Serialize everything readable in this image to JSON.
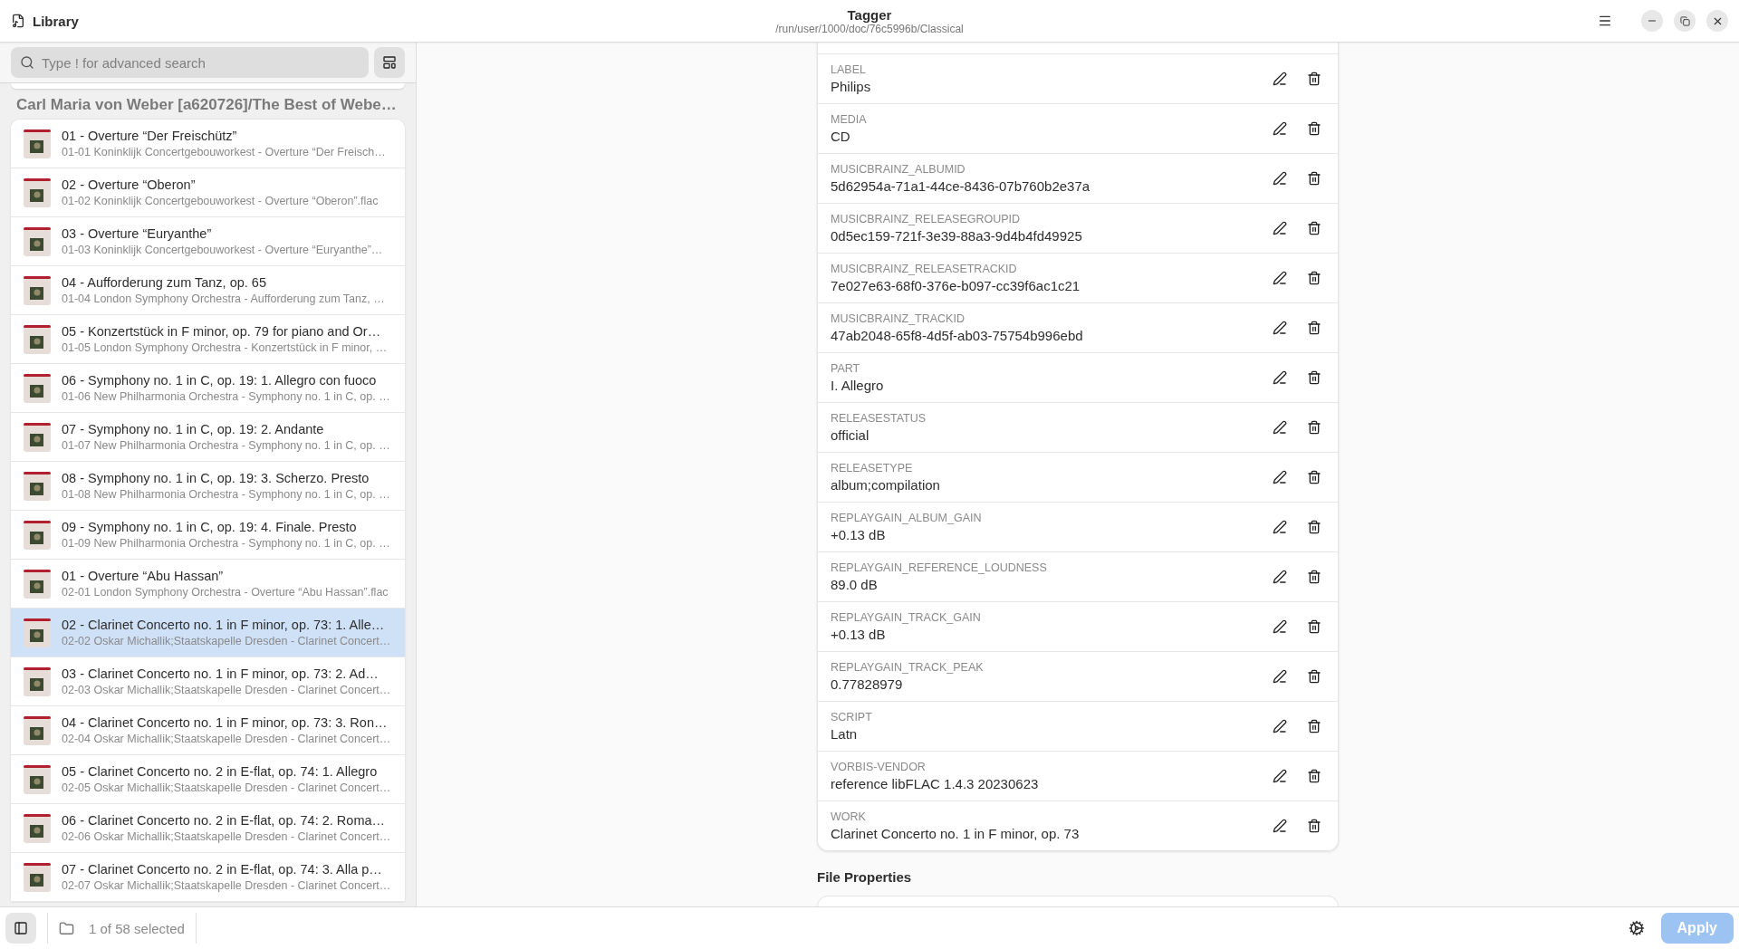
{
  "header": {
    "left_title": "Library",
    "title": "Tagger",
    "subtitle": "/run/user/1000/doc/76c5996b/Classical"
  },
  "search": {
    "placeholder": "Type ! for advanced search"
  },
  "album": {
    "heading": "Carl Maria von Weber [a620726]/The Best of Webe…"
  },
  "tracks": [
    {
      "title": "01 - Overture “Der Freischütz”",
      "file": "01-01 Koninklijk Concertgebouworkest - Overture “Der Freisch…",
      "selected": false
    },
    {
      "title": "02 - Overture “Oberon”",
      "file": "01-02 Koninklijk Concertgebouworkest - Overture “Oberon”.flac",
      "selected": false
    },
    {
      "title": "03 - Overture “Euryanthe”",
      "file": "01-03 Koninklijk Concertgebouworkest - Overture “Euryanthe”…",
      "selected": false
    },
    {
      "title": "04 - Aufforderung zum Tanz, op. 65",
      "file": "01-04 London Symphony Orchestra - Aufforderung zum Tanz, …",
      "selected": false
    },
    {
      "title": "05 - Konzertstück in F minor, op. 79 for piano and Or…",
      "file": "01-05 London Symphony Orchestra - Konzertstück in F minor, …",
      "selected": false
    },
    {
      "title": "06 - Symphony no. 1 in C, op. 19: 1. Allegro con fuoco",
      "file": "01-06 New Philharmonia Orchestra - Symphony no. 1 in C, op. …",
      "selected": false
    },
    {
      "title": "07 - Symphony no. 1 in C, op. 19: 2. Andante",
      "file": "01-07 New Philharmonia Orchestra - Symphony no. 1 in C, op. …",
      "selected": false
    },
    {
      "title": "08 - Symphony no. 1 in C, op. 19: 3. Scherzo. Presto",
      "file": "01-08 New Philharmonia Orchestra - Symphony no. 1 in C, op. …",
      "selected": false
    },
    {
      "title": "09 - Symphony no. 1 in C, op. 19: 4. Finale. Presto",
      "file": "01-09 New Philharmonia Orchestra - Symphony no. 1 in C, op. …",
      "selected": false
    },
    {
      "title": "01 - Overture “Abu Hassan”",
      "file": "02-01 London Symphony Orchestra - Overture “Abu Hassan”.flac",
      "selected": false
    },
    {
      "title": "02 - Clarinet Concerto no. 1 in F minor, op. 73: 1. Alle…",
      "file": "02-02 Oskar Michallik;Staatskapelle Dresden - Clarinet Concert…",
      "selected": true
    },
    {
      "title": "03 - Clarinet Concerto no. 1 in F minor, op. 73: 2. Ad…",
      "file": "02-03 Oskar Michallik;Staatskapelle Dresden - Clarinet Concert…",
      "selected": false
    },
    {
      "title": "04 - Clarinet Concerto no. 1 in F minor, op. 73: 3. Ron…",
      "file": "02-04 Oskar Michallik;Staatskapelle Dresden - Clarinet Concert…",
      "selected": false
    },
    {
      "title": "05 - Clarinet Concerto no. 2 in E-flat, op. 74: 1. Allegro",
      "file": "02-05 Oskar Michallik;Staatskapelle Dresden - Clarinet Concert…",
      "selected": false
    },
    {
      "title": "06 - Clarinet Concerto no. 2 in E-flat, op. 74: 2. Roma…",
      "file": "02-06 Oskar Michallik;Staatskapelle Dresden - Clarinet Concert…",
      "selected": false
    },
    {
      "title": "07 - Clarinet Concerto no. 2 in E-flat, op. 74: 3. Alla p…",
      "file": "02-07 Oskar Michallik;Staatskapelle Dresden - Clarinet Concert…",
      "selected": false
    }
  ],
  "tags": [
    {
      "name": "LABEL",
      "value": "Philips"
    },
    {
      "name": "MEDIA",
      "value": "CD"
    },
    {
      "name": "MUSICBRAINZ_ALBUMID",
      "value": "5d62954a-71a1-44ce-8436-07b760b2e37a"
    },
    {
      "name": "MUSICBRAINZ_RELEASEGROUPID",
      "value": "0d5ec159-721f-3e39-88a3-9d4b4fd49925"
    },
    {
      "name": "MUSICBRAINZ_RELEASETRACKID",
      "value": "7e027e63-68f0-376e-b097-cc39f6ac1c21"
    },
    {
      "name": "MUSICBRAINZ_TRACKID",
      "value": "47ab2048-65f8-4d5f-ab03-75754b996ebd"
    },
    {
      "name": "PART",
      "value": "I. Allegro"
    },
    {
      "name": "RELEASESTATUS",
      "value": "official"
    },
    {
      "name": "RELEASETYPE",
      "value": "album;compilation"
    },
    {
      "name": "REPLAYGAIN_ALBUM_GAIN",
      "value": "+0.13 dB"
    },
    {
      "name": "REPLAYGAIN_REFERENCE_LOUDNESS",
      "value": "89.0 dB"
    },
    {
      "name": "REPLAYGAIN_TRACK_GAIN",
      "value": "+0.13 dB"
    },
    {
      "name": "REPLAYGAIN_TRACK_PEAK",
      "value": "0.77828979"
    },
    {
      "name": "SCRIPT",
      "value": "Latn"
    },
    {
      "name": "VORBIS-VENDOR",
      "value": "reference libFLAC 1.4.3 20230623"
    },
    {
      "name": "WORK",
      "value": "Clarinet Concerto no. 1 in F minor, op. 73"
    }
  ],
  "file_properties": {
    "heading": "File Properties"
  },
  "status_bar": {
    "selection": "1 of 58 selected",
    "apply": {
      "label": "Apply",
      "disabled": true
    }
  }
}
